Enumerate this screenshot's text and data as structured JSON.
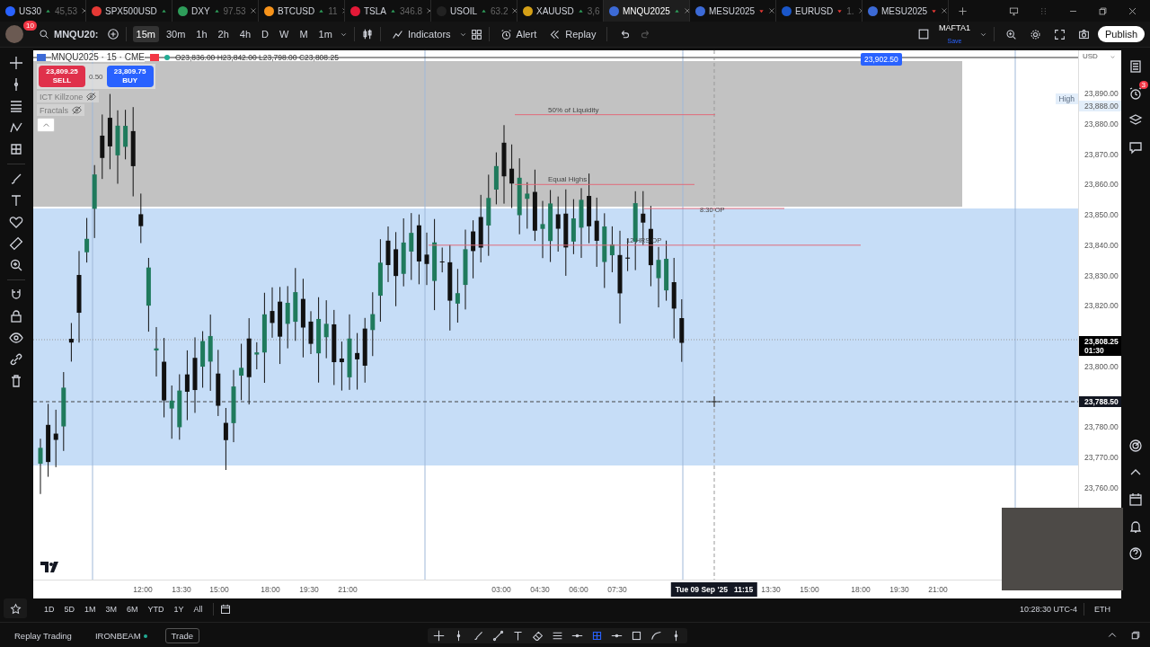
{
  "tabs": [
    {
      "symbol": "US30",
      "price": "45,53",
      "rising": true,
      "color": "#2962ff",
      "selected": false
    },
    {
      "symbol": "SPX500USD",
      "rising": true,
      "color": "#e53935",
      "selected": false
    },
    {
      "symbol": "DXY",
      "price": "97.53",
      "rising": true,
      "color": "#2e9d5a",
      "selected": false
    },
    {
      "symbol": "BTCUSD",
      "price": "11",
      "rising": true,
      "color": "#f7931a",
      "selected": false
    },
    {
      "symbol": "TSLA",
      "price": "346.8",
      "rising": true,
      "color": "#e31937",
      "selected": false
    },
    {
      "symbol": "USOIL",
      "price": "63.2",
      "rising": true,
      "color": "#222222",
      "selected": false
    },
    {
      "symbol": "XAUUSD",
      "price": "3,6",
      "rising": true,
      "color": "#d4a017",
      "selected": false
    },
    {
      "symbol": "MNQU2025",
      "rising": true,
      "color": "#3c6ad6",
      "selected": true
    },
    {
      "symbol": "MESU2025",
      "rising": false,
      "color": "#3c6ad6",
      "selected": false
    },
    {
      "symbol": "EURUSD",
      "price": "1.",
      "rising": false,
      "color": "#1a56c9",
      "selected": false
    },
    {
      "symbol": "MESU2025",
      "rising": false,
      "color": "#3c6ad6",
      "selected": false
    }
  ],
  "toolbar": {
    "avatar_badge": "10",
    "symbol": "MNQU20:",
    "intervals": [
      {
        "label": "15m",
        "selected": true
      },
      {
        "label": "30m",
        "selected": false
      },
      {
        "label": "1h",
        "selected": false
      },
      {
        "label": "2h",
        "selected": false
      },
      {
        "label": "4h",
        "selected": false
      },
      {
        "label": "D",
        "selected": false
      },
      {
        "label": "W",
        "selected": false
      },
      {
        "label": "M",
        "selected": false
      },
      {
        "label": "1m",
        "selected": false
      }
    ],
    "indicators": "Indicators",
    "alert": "Alert",
    "replay": "Replay",
    "layout_name": "MAFTA1",
    "layout_status": "Save",
    "publish": "Publish"
  },
  "legend": {
    "title": "MNQU2025 · 15 · CME",
    "ohlc": "O23,836.00 H23,842.00 L23,798.00 C23,808.25",
    "sell": {
      "price": "23,809.25",
      "label": "SELL"
    },
    "spread": "0.50",
    "buy": {
      "price": "23,809.75",
      "label": "BUY"
    },
    "studies": [
      {
        "name": "ICT Killzone",
        "visible": false
      },
      {
        "name": "Fractals",
        "visible": false
      }
    ]
  },
  "annotations": [
    {
      "text": "50% of Liquidity"
    },
    {
      "text": "Equal Highs"
    },
    {
      "text": "8:30 OP"
    },
    {
      "text": "12 HRS OP"
    }
  ],
  "price_axis": {
    "currency": "USD",
    "top_label": "23,902.50",
    "ticks": [
      "23,890.00",
      "23,880.00",
      "23,870.00",
      "23,860.00",
      "23,850.00",
      "23,840.00",
      "23,830.00",
      "23,820.00",
      "23,800.00",
      "23,780.00",
      "23,770.00",
      "23,760.00"
    ],
    "high_label": "High",
    "high_price": "23,888.00",
    "last_price": "23,808.25",
    "countdown": "01:30",
    "crosshair_price": "23,788.50"
  },
  "time_axis": {
    "ticks": [
      "12:00",
      "13:30",
      "15:00",
      "18:00",
      "19:30",
      "21:00",
      "03:00",
      "04:30",
      "06:00",
      "07:30",
      "13:30",
      "15:00",
      "18:00",
      "19:30",
      "21:00"
    ],
    "crosshair_time": "Tue 09 Sep '25   11:15"
  },
  "range_bar": {
    "ranges": [
      "1D",
      "5D",
      "1M",
      "3M",
      "6M",
      "YTD",
      "1Y",
      "All"
    ],
    "clock": "10:28:30 UTC-4",
    "session": "ETH"
  },
  "bottom_bar": {
    "replay": "Replay Trading",
    "broker": "IRONBEAM",
    "trade": "Trade"
  },
  "sidebar": {
    "alerts_badge": "3"
  }
}
